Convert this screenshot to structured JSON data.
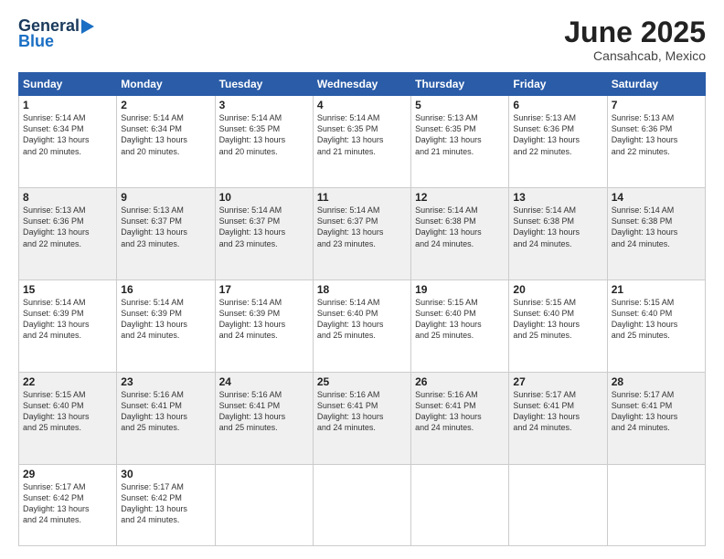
{
  "header": {
    "logo_general": "General",
    "logo_blue": "Blue",
    "month_title": "June 2025",
    "location": "Cansahcab, Mexico"
  },
  "weekdays": [
    "Sunday",
    "Monday",
    "Tuesday",
    "Wednesday",
    "Thursday",
    "Friday",
    "Saturday"
  ],
  "weeks": [
    [
      {
        "day": "1",
        "info": "Sunrise: 5:14 AM\nSunset: 6:34 PM\nDaylight: 13 hours\nand 20 minutes."
      },
      {
        "day": "2",
        "info": "Sunrise: 5:14 AM\nSunset: 6:34 PM\nDaylight: 13 hours\nand 20 minutes."
      },
      {
        "day": "3",
        "info": "Sunrise: 5:14 AM\nSunset: 6:35 PM\nDaylight: 13 hours\nand 20 minutes."
      },
      {
        "day": "4",
        "info": "Sunrise: 5:14 AM\nSunset: 6:35 PM\nDaylight: 13 hours\nand 21 minutes."
      },
      {
        "day": "5",
        "info": "Sunrise: 5:13 AM\nSunset: 6:35 PM\nDaylight: 13 hours\nand 21 minutes."
      },
      {
        "day": "6",
        "info": "Sunrise: 5:13 AM\nSunset: 6:36 PM\nDaylight: 13 hours\nand 22 minutes."
      },
      {
        "day": "7",
        "info": "Sunrise: 5:13 AM\nSunset: 6:36 PM\nDaylight: 13 hours\nand 22 minutes."
      }
    ],
    [
      {
        "day": "8",
        "info": "Sunrise: 5:13 AM\nSunset: 6:36 PM\nDaylight: 13 hours\nand 22 minutes."
      },
      {
        "day": "9",
        "info": "Sunrise: 5:13 AM\nSunset: 6:37 PM\nDaylight: 13 hours\nand 23 minutes."
      },
      {
        "day": "10",
        "info": "Sunrise: 5:14 AM\nSunset: 6:37 PM\nDaylight: 13 hours\nand 23 minutes."
      },
      {
        "day": "11",
        "info": "Sunrise: 5:14 AM\nSunset: 6:37 PM\nDaylight: 13 hours\nand 23 minutes."
      },
      {
        "day": "12",
        "info": "Sunrise: 5:14 AM\nSunset: 6:38 PM\nDaylight: 13 hours\nand 24 minutes."
      },
      {
        "day": "13",
        "info": "Sunrise: 5:14 AM\nSunset: 6:38 PM\nDaylight: 13 hours\nand 24 minutes."
      },
      {
        "day": "14",
        "info": "Sunrise: 5:14 AM\nSunset: 6:38 PM\nDaylight: 13 hours\nand 24 minutes."
      }
    ],
    [
      {
        "day": "15",
        "info": "Sunrise: 5:14 AM\nSunset: 6:39 PM\nDaylight: 13 hours\nand 24 minutes."
      },
      {
        "day": "16",
        "info": "Sunrise: 5:14 AM\nSunset: 6:39 PM\nDaylight: 13 hours\nand 24 minutes."
      },
      {
        "day": "17",
        "info": "Sunrise: 5:14 AM\nSunset: 6:39 PM\nDaylight: 13 hours\nand 24 minutes."
      },
      {
        "day": "18",
        "info": "Sunrise: 5:14 AM\nSunset: 6:40 PM\nDaylight: 13 hours\nand 25 minutes."
      },
      {
        "day": "19",
        "info": "Sunrise: 5:15 AM\nSunset: 6:40 PM\nDaylight: 13 hours\nand 25 minutes."
      },
      {
        "day": "20",
        "info": "Sunrise: 5:15 AM\nSunset: 6:40 PM\nDaylight: 13 hours\nand 25 minutes."
      },
      {
        "day": "21",
        "info": "Sunrise: 5:15 AM\nSunset: 6:40 PM\nDaylight: 13 hours\nand 25 minutes."
      }
    ],
    [
      {
        "day": "22",
        "info": "Sunrise: 5:15 AM\nSunset: 6:40 PM\nDaylight: 13 hours\nand 25 minutes."
      },
      {
        "day": "23",
        "info": "Sunrise: 5:16 AM\nSunset: 6:41 PM\nDaylight: 13 hours\nand 25 minutes."
      },
      {
        "day": "24",
        "info": "Sunrise: 5:16 AM\nSunset: 6:41 PM\nDaylight: 13 hours\nand 25 minutes."
      },
      {
        "day": "25",
        "info": "Sunrise: 5:16 AM\nSunset: 6:41 PM\nDaylight: 13 hours\nand 24 minutes."
      },
      {
        "day": "26",
        "info": "Sunrise: 5:16 AM\nSunset: 6:41 PM\nDaylight: 13 hours\nand 24 minutes."
      },
      {
        "day": "27",
        "info": "Sunrise: 5:17 AM\nSunset: 6:41 PM\nDaylight: 13 hours\nand 24 minutes."
      },
      {
        "day": "28",
        "info": "Sunrise: 5:17 AM\nSunset: 6:41 PM\nDaylight: 13 hours\nand 24 minutes."
      }
    ],
    [
      {
        "day": "29",
        "info": "Sunrise: 5:17 AM\nSunset: 6:42 PM\nDaylight: 13 hours\nand 24 minutes."
      },
      {
        "day": "30",
        "info": "Sunrise: 5:17 AM\nSunset: 6:42 PM\nDaylight: 13 hours\nand 24 minutes."
      },
      {
        "day": "",
        "info": ""
      },
      {
        "day": "",
        "info": ""
      },
      {
        "day": "",
        "info": ""
      },
      {
        "day": "",
        "info": ""
      },
      {
        "day": "",
        "info": ""
      }
    ]
  ]
}
